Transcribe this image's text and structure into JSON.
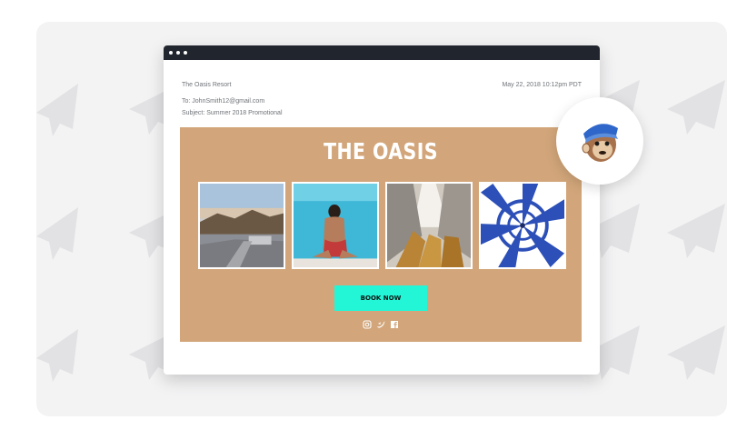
{
  "email": {
    "from": "The Oasis Resort",
    "date": "May 22, 2018 10:12pm PDT",
    "to": "To: JohnSmith12@gmail.com",
    "subject": "Subject: Summer 2018 Promotional"
  },
  "campaign": {
    "title": "THE OASIS",
    "cta_label": "BOOK NOW",
    "background_color": "#d2a67a",
    "cta_color": "#22f6d7",
    "photos": [
      "mountain-terrace-photo",
      "pool-woman-photo",
      "curtains-photo",
      "striped-umbrella-photo"
    ],
    "socials": [
      "instagram-icon",
      "twitter-icon",
      "facebook-icon"
    ]
  },
  "badge": {
    "icon": "mailchimp-logo"
  }
}
